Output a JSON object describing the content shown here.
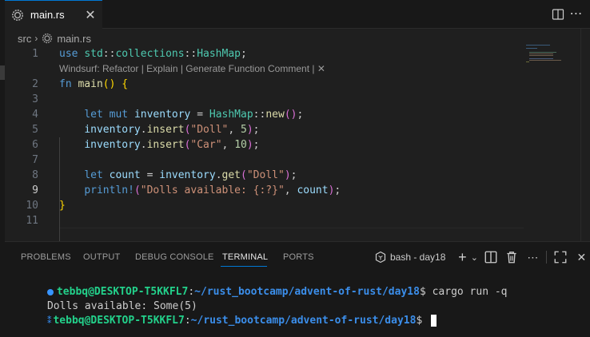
{
  "tab": {
    "filename": "main.rs",
    "close_glyph": "✕"
  },
  "breadcrumb": {
    "folder": "src",
    "file": "main.rs"
  },
  "codelens": "Windsurf: Refactor | Explain | Generate Function Comment | ✕",
  "editor": {
    "active_line": "9",
    "line_numbers": [
      "1",
      "2",
      "3",
      "4",
      "5",
      "6",
      "7",
      "8",
      "9",
      "10",
      "11"
    ],
    "lines": [
      [
        [
          "kw",
          "use"
        ],
        [
          "pun",
          " "
        ],
        [
          "ty",
          "std"
        ],
        [
          "pun",
          "::"
        ],
        [
          "ty",
          "collections"
        ],
        [
          "pun",
          "::"
        ],
        [
          "ty",
          "HashMap"
        ],
        [
          "pun",
          ";"
        ]
      ],
      [
        [
          "kw",
          "fn"
        ],
        [
          "pun",
          " "
        ],
        [
          "fn",
          "main"
        ],
        [
          "br1",
          "()"
        ],
        [
          "pun",
          " "
        ],
        [
          "br1",
          "{"
        ]
      ],
      [],
      [
        [
          "pun",
          "    "
        ],
        [
          "kw",
          "let"
        ],
        [
          "pun",
          " "
        ],
        [
          "kw",
          "mut"
        ],
        [
          "pun",
          " "
        ],
        [
          "var",
          "inventory"
        ],
        [
          "pun",
          " = "
        ],
        [
          "ty",
          "HashMap"
        ],
        [
          "pun",
          "::"
        ],
        [
          "fn",
          "new"
        ],
        [
          "br2",
          "()"
        ],
        [
          "pun",
          ";"
        ]
      ],
      [
        [
          "pun",
          "    "
        ],
        [
          "var",
          "inventory"
        ],
        [
          "pun",
          "."
        ],
        [
          "fn",
          "insert"
        ],
        [
          "br2",
          "("
        ],
        [
          "str",
          "\"Doll\""
        ],
        [
          "pun",
          ", "
        ],
        [
          "num",
          "5"
        ],
        [
          "br2",
          ")"
        ],
        [
          "pun",
          ";"
        ]
      ],
      [
        [
          "pun",
          "    "
        ],
        [
          "var",
          "inventory"
        ],
        [
          "pun",
          "."
        ],
        [
          "fn",
          "insert"
        ],
        [
          "br2",
          "("
        ],
        [
          "str",
          "\"Car\""
        ],
        [
          "pun",
          ", "
        ],
        [
          "num",
          "10"
        ],
        [
          "br2",
          ")"
        ],
        [
          "pun",
          ";"
        ]
      ],
      [],
      [
        [
          "pun",
          "    "
        ],
        [
          "kw",
          "let"
        ],
        [
          "pun",
          " "
        ],
        [
          "var",
          "count"
        ],
        [
          "pun",
          " = "
        ],
        [
          "var",
          "inventory"
        ],
        [
          "pun",
          "."
        ],
        [
          "fn",
          "get"
        ],
        [
          "br2",
          "("
        ],
        [
          "str",
          "\"Doll\""
        ],
        [
          "br2",
          ")"
        ],
        [
          "pun",
          ";"
        ]
      ],
      [
        [
          "pun",
          "    "
        ],
        [
          "mac",
          "println!"
        ],
        [
          "br2",
          "("
        ],
        [
          "str",
          "\"Dolls available: {:?}\""
        ],
        [
          "pun",
          ", "
        ],
        [
          "var",
          "count"
        ],
        [
          "br2",
          ")"
        ],
        [
          "pun",
          ";"
        ]
      ],
      [
        [
          "br1",
          "}"
        ]
      ],
      []
    ]
  },
  "panel": {
    "tabs": [
      "PROBLEMS",
      "OUTPUT",
      "DEBUG CONSOLE",
      "TERMINAL",
      "PORTS"
    ],
    "active_tab": "TERMINAL",
    "terminal_name": "bash - day18"
  },
  "terminal": {
    "prompt_user": "tebbq@DESKTOP-T5KKFL7",
    "prompt_sep": ":",
    "prompt_path": "~/rust_bootcamp/advent-of-rust/day18",
    "prompt_dollar": "$ ",
    "command": "cargo run -q",
    "output": "Dolls available: Some(5)"
  },
  "colors": {
    "background": "#1f1f1f",
    "accent": "#0078d4",
    "terminal_user": "#23d18b",
    "terminal_path": "#3b8eea"
  },
  "icons": {
    "tab_file": "rust-file-icon",
    "split": "split-editor-icon",
    "more": "more-actions-icon",
    "terminal_kind": "terminal-icon",
    "add": "add-terminal-icon",
    "split_terminal": "split-terminal-icon",
    "trash": "kill-terminal-icon",
    "maximize": "maximize-panel-icon",
    "close_panel": "close-panel-icon"
  }
}
